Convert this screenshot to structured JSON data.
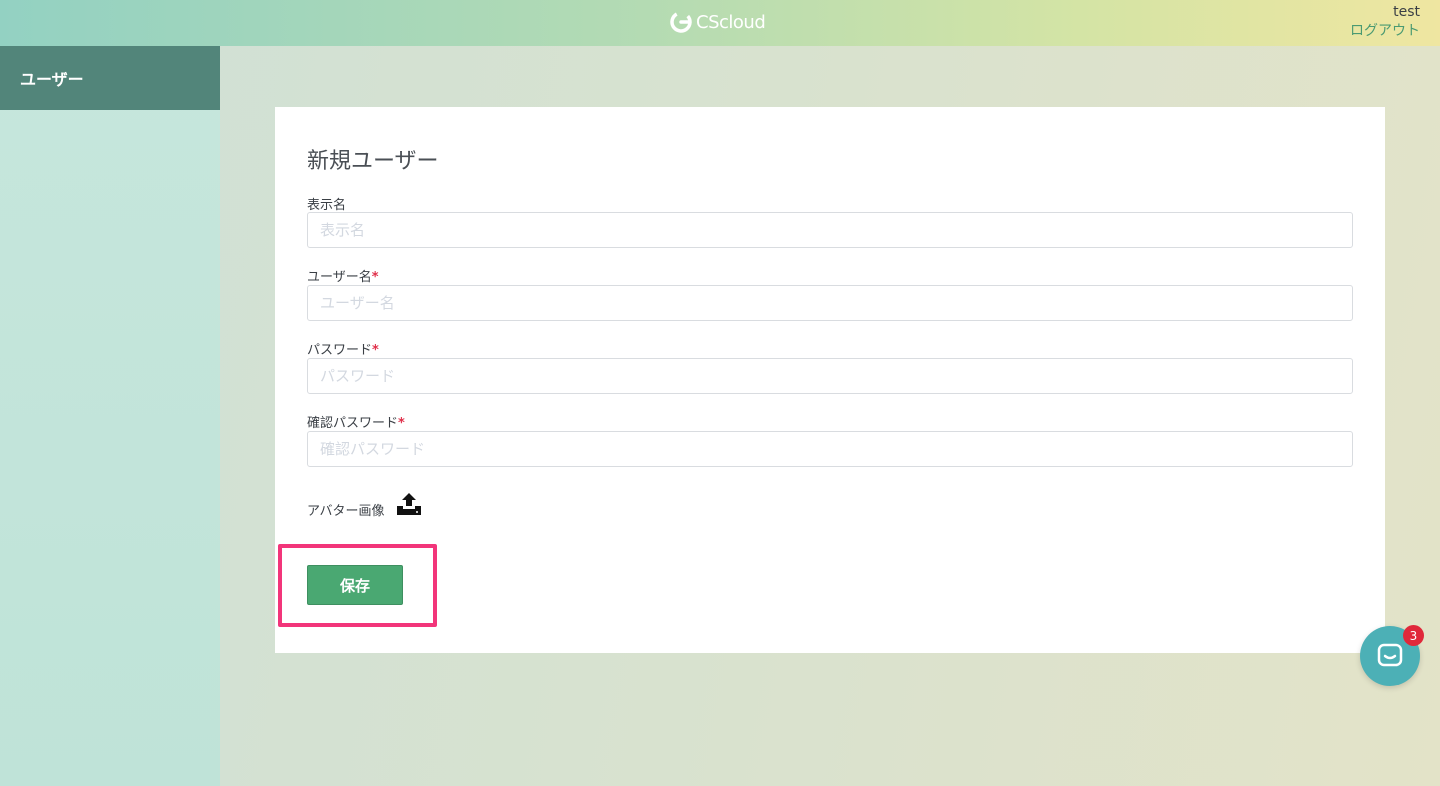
{
  "header": {
    "logo_text": "CScloud",
    "user_name": "test",
    "logout_label": "ログアウト"
  },
  "sidebar": {
    "items": [
      {
        "label": "ユーザー",
        "active": true
      }
    ]
  },
  "form": {
    "title": "新規ユーザー",
    "fields": [
      {
        "label": "表示名",
        "required": false,
        "placeholder": "表示名",
        "value": ""
      },
      {
        "label": "ユーザー名",
        "required": true,
        "placeholder": "ユーザー名",
        "value": ""
      },
      {
        "label": "パスワード",
        "required": true,
        "placeholder": "パスワード",
        "value": ""
      },
      {
        "label": "確認パスワード",
        "required": true,
        "placeholder": "確認パスワード",
        "value": ""
      }
    ],
    "required_mark": "*",
    "avatar_label": "アバター画像",
    "avatar_icon": "upload-icon",
    "save_label": "保存"
  },
  "chat": {
    "icon": "chat-icon",
    "badge_count": "3"
  },
  "colors": {
    "sidebar_active": "#52857a",
    "save_button": "#4aa872",
    "highlight": "#f2357a",
    "required_mark": "#e0304a",
    "chat_bubble": "#4cb0b6",
    "badge": "#e0283a"
  }
}
